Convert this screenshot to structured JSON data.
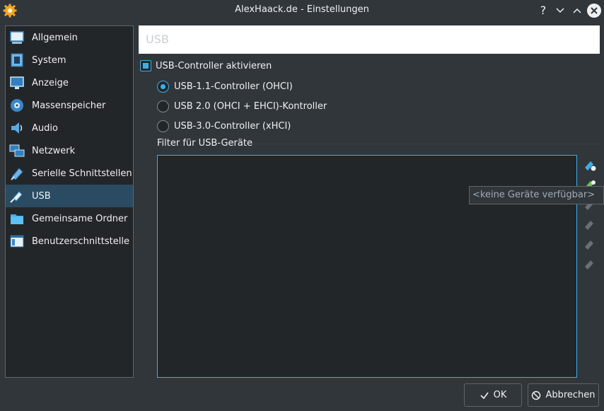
{
  "window": {
    "title": "AlexHaack.de - Einstellungen",
    "help": "?",
    "minimize": "⌄",
    "maximize": "⌃",
    "close": "✕"
  },
  "sidebar": {
    "items": [
      {
        "label": "Allgemein",
        "icon": "general-icon"
      },
      {
        "label": "System",
        "icon": "system-chip-icon"
      },
      {
        "label": "Anzeige",
        "icon": "display-monitor-icon"
      },
      {
        "label": "Massenspeicher",
        "icon": "storage-disk-icon"
      },
      {
        "label": "Audio",
        "icon": "speaker-icon"
      },
      {
        "label": "Netzwerk",
        "icon": "network-icon"
      },
      {
        "label": "Serielle Schnittstellen",
        "icon": "serial-port-icon"
      },
      {
        "label": "USB",
        "icon": "usb-icon"
      },
      {
        "label": "Gemeinsame Ordner",
        "icon": "folder-icon"
      },
      {
        "label": "Benutzerschnittstelle",
        "icon": "user-interface-icon"
      }
    ],
    "selected": "USB"
  },
  "header": {
    "title": "USB"
  },
  "usb": {
    "enable_label": "USB-Controller aktivieren",
    "enabled": true,
    "controllers": [
      {
        "label": "USB-1.1-Controller (OHCI)",
        "checked": true
      },
      {
        "label": "USB 2.0 (OHCI + EHCI)-Kontroller",
        "checked": false
      },
      {
        "label": "USB-3.0-Controller (xHCI)",
        "checked": false
      }
    ],
    "filter_label": "Filter für USB-Geräte",
    "tooltip": "<keine Geräte verfügbar>"
  },
  "buttons": {
    "ok": "OK",
    "cancel": "Abbrechen"
  },
  "colors": {
    "accent": "#3daee9",
    "background": "#31363b",
    "panel": "#232629",
    "selection": "#2a4b62"
  }
}
